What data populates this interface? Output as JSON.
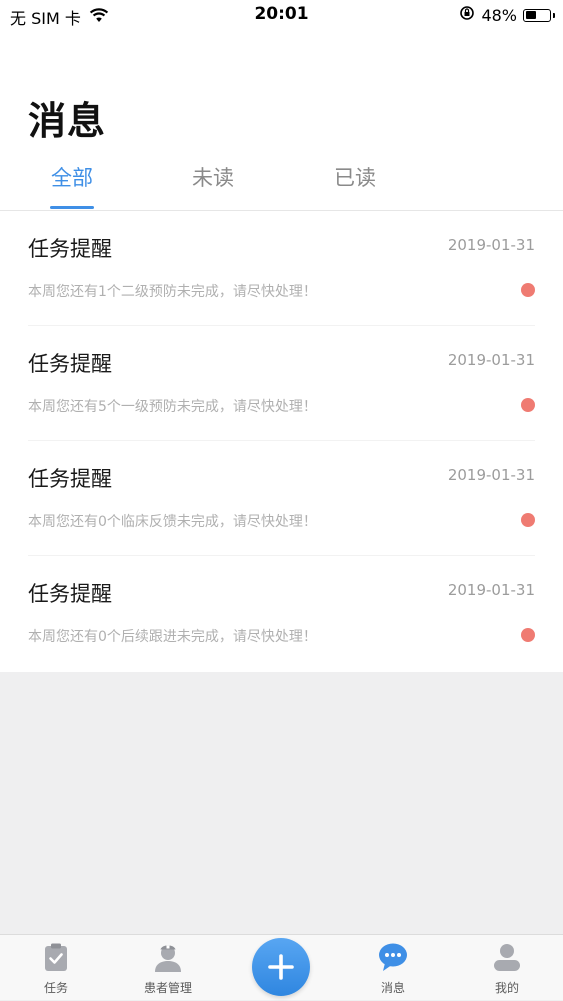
{
  "status_bar": {
    "carrier": "无 SIM 卡",
    "time": "20:01",
    "battery": "48%",
    "battery_level": 0.48
  },
  "page": {
    "title": "消息"
  },
  "tabs": [
    {
      "label": "全部",
      "active": true
    },
    {
      "label": "未读",
      "active": false
    },
    {
      "label": "已读",
      "active": false
    }
  ],
  "messages": [
    {
      "title": "任务提醒",
      "date": "2019-01-31",
      "body": "本周您还有1个二级预防未完成，请尽快处理！",
      "unread": true
    },
    {
      "title": "任务提醒",
      "date": "2019-01-31",
      "body": "本周您还有5个一级预防未完成，请尽快处理！",
      "unread": true
    },
    {
      "title": "任务提醒",
      "date": "2019-01-31",
      "body": "本周您还有0个临床反馈未完成，请尽快处理！",
      "unread": true
    },
    {
      "title": "任务提醒",
      "date": "2019-01-31",
      "body": "本周您还有0个后续跟进未完成，请尽快处理！",
      "unread": true
    }
  ],
  "tab_bar": {
    "items": [
      {
        "label": "任务",
        "icon": "clipboard-check-icon"
      },
      {
        "label": "患者管理",
        "icon": "nurse-icon"
      },
      {
        "label": "",
        "icon": "plus-icon"
      },
      {
        "label": "消息",
        "icon": "chat-bubble-icon",
        "active": true
      },
      {
        "label": "我的",
        "icon": "person-icon"
      }
    ]
  },
  "colors": {
    "accent": "#3f8fe6",
    "unread_dot": "#ef7b72",
    "inactive_icon": "#a8aab0"
  }
}
